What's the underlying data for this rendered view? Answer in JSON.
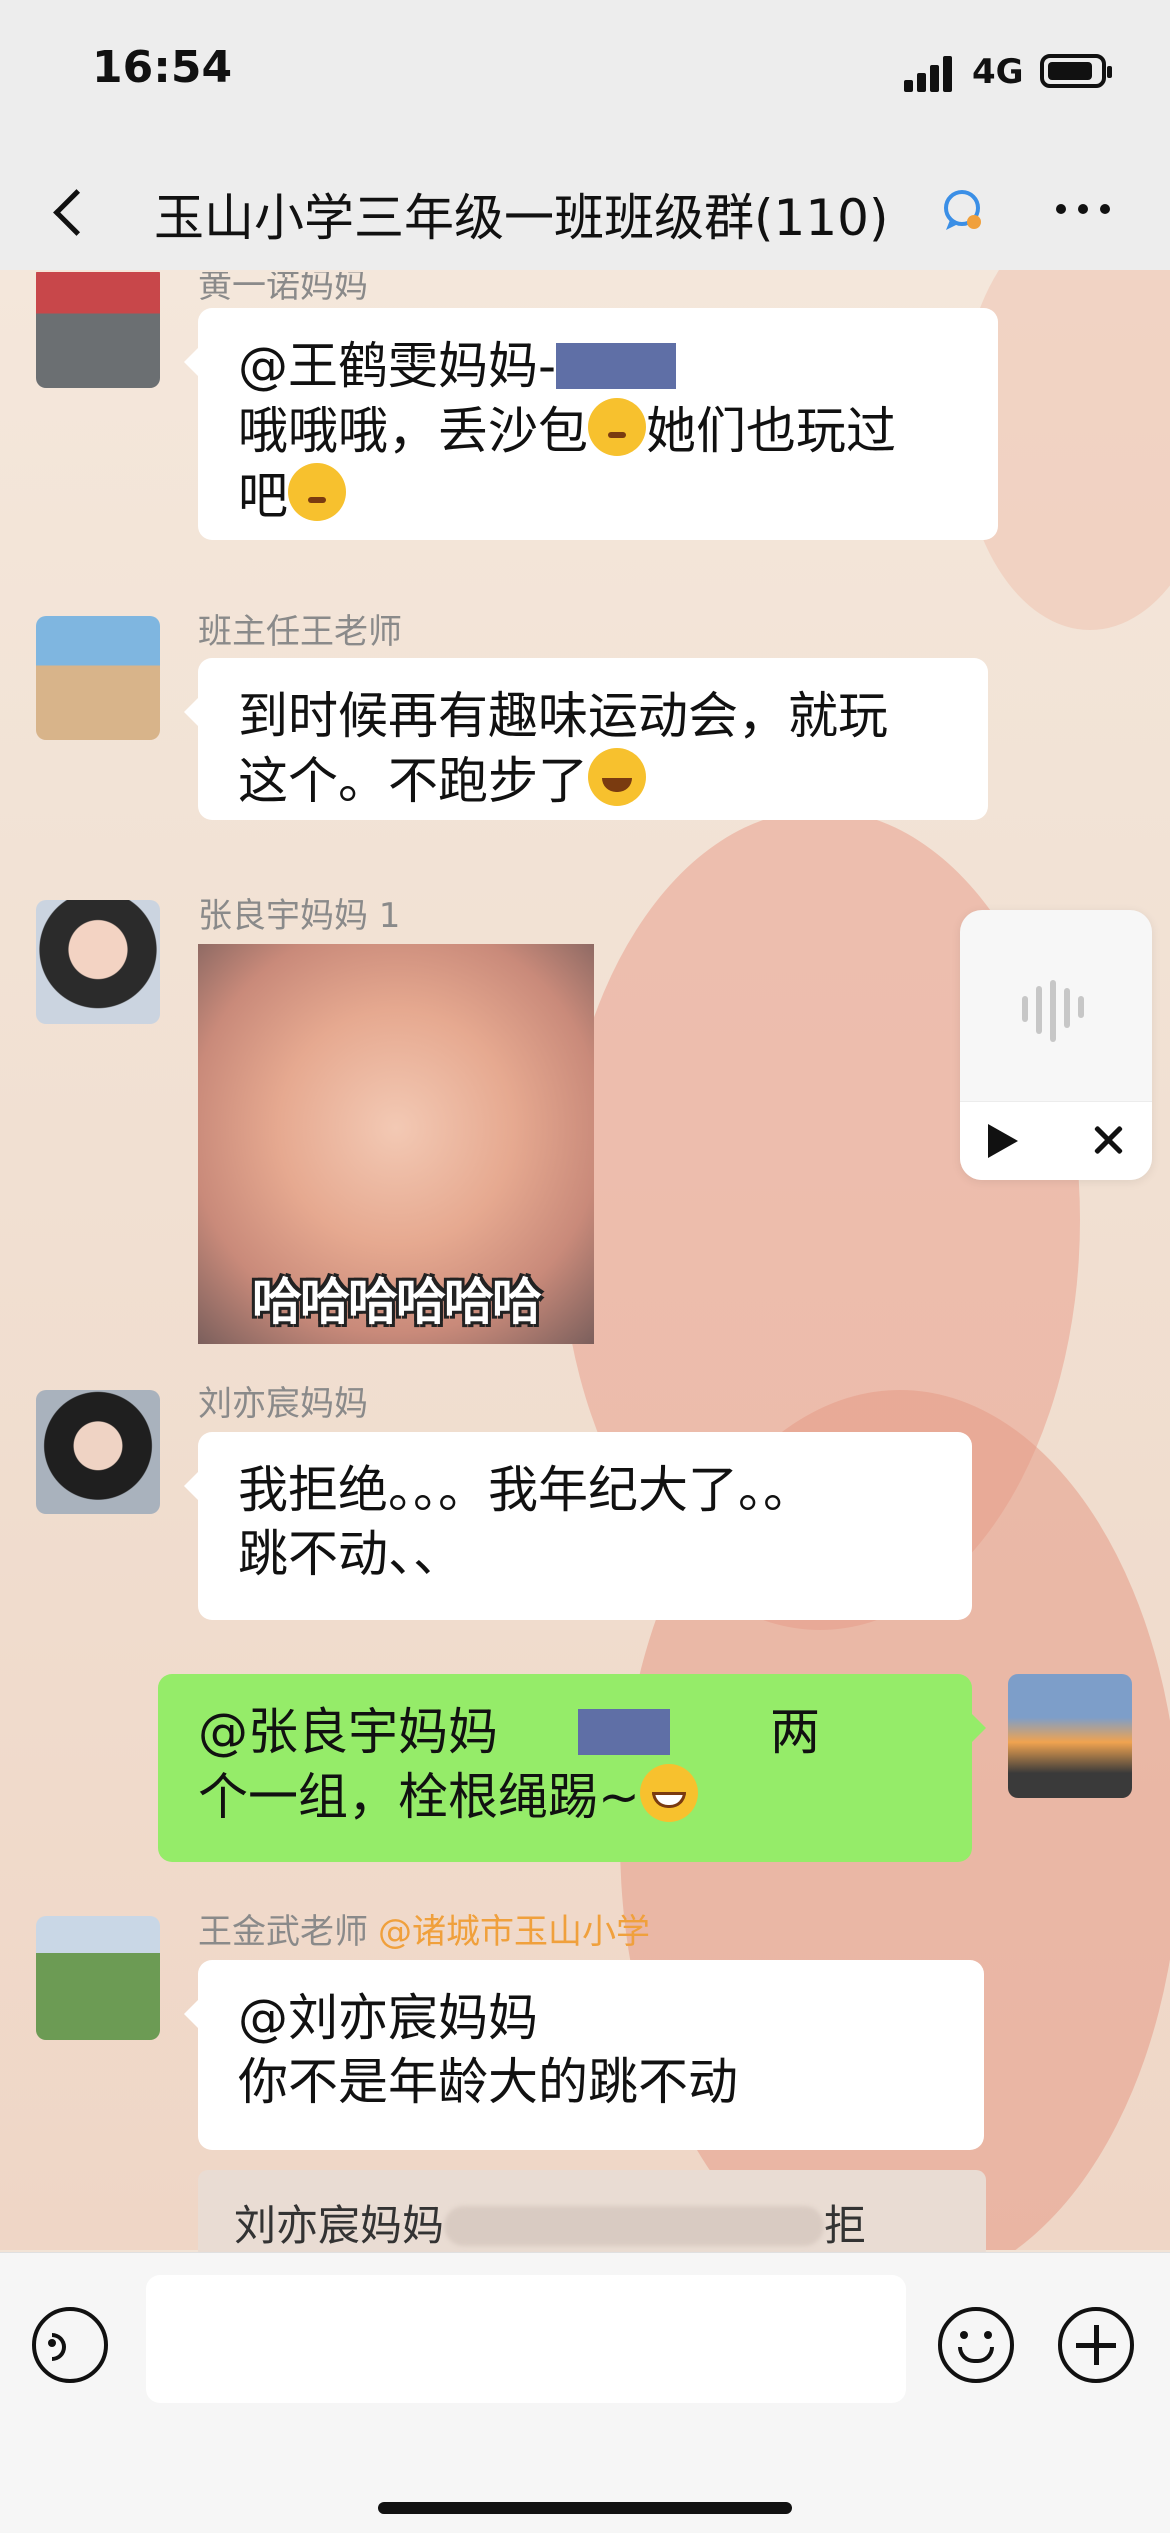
{
  "status_bar": {
    "time": "16:54",
    "network": "4G"
  },
  "nav": {
    "title": "玉山小学三年级一班班级群(110)"
  },
  "messages": {
    "m0": {
      "sender_partial": "黄一诺妈妈",
      "line1_prefix": "@王鹤雯妈妈-",
      "line2": "哦哦哦，丢沙包",
      "line2_after": "她们也玩过",
      "line3": "吧"
    },
    "m1": {
      "sender": "班主任王老师",
      "line1": "到时候再有趣味运动会，就玩",
      "line2": "这个。不跑步了"
    },
    "m2": {
      "sender": "张良宇妈妈 1",
      "sticker_caption": "哈哈哈哈哈哈"
    },
    "m3": {
      "sender": "刘亦宸妈妈",
      "line1": "我拒绝。。。我年纪大了。。",
      "line2": "跳不动、、"
    },
    "m4": {
      "line1_prefix": "@张良宇妈妈",
      "line1_suffix": "两",
      "line2": "个一组，栓根绳踢~"
    },
    "m5": {
      "sender": "王金武老师",
      "sender_org": "@诸城市玉山小学",
      "line1": "@刘亦宸妈妈",
      "line2": "你不是年龄大的跳不动"
    },
    "quote": {
      "prefix": "刘亦宸妈妈",
      "suffix": "拒"
    }
  },
  "icons": {
    "back": "chevron-left-icon",
    "more": "more-dots-icon",
    "voice": "voice-input-icon",
    "emoji": "emoji-icon",
    "plus": "plus-icon",
    "play": "play-icon",
    "close": "close-icon"
  },
  "colors": {
    "my_bubble": "#95ec69",
    "other_bubble": "#ffffff",
    "org_label": "#f0a03c"
  }
}
